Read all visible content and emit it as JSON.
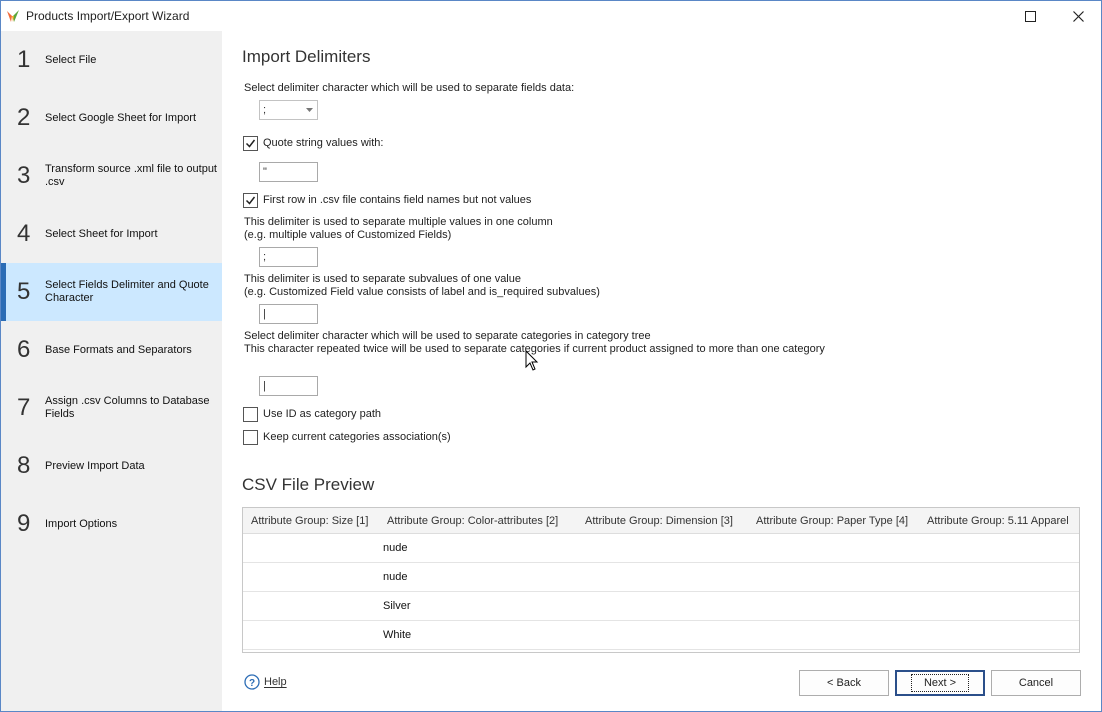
{
  "window": {
    "title": "Products Import/Export Wizard"
  },
  "sidebar": {
    "steps": [
      {
        "num": "1",
        "label": "Select File"
      },
      {
        "num": "2",
        "label": "Select Google Sheet for Import"
      },
      {
        "num": "3",
        "label": "Transform source .xml file to output .csv"
      },
      {
        "num": "4",
        "label": "Select Sheet for Import"
      },
      {
        "num": "5",
        "label": "Select Fields Delimiter and Quote Character"
      },
      {
        "num": "6",
        "label": "Base Formats and Separators"
      },
      {
        "num": "7",
        "label": "Assign .csv Columns to Database Fields"
      },
      {
        "num": "8",
        "label": "Preview Import Data"
      },
      {
        "num": "9",
        "label": "Import Options"
      }
    ]
  },
  "delimiters": {
    "title": "Import Delimiters",
    "field_delim_label": "Select delimiter character which will be used to separate fields data:",
    "field_delim_value": ";",
    "quote_label": "Quote string values with:",
    "quote_checked": true,
    "quote_value": "\"",
    "first_row_label": "First row in .csv file contains field names but not values",
    "first_row_checked": true,
    "multi_label_1": "This delimiter is used to separate multiple values in one column",
    "multi_label_2": "(e.g. multiple values of Customized Fields)",
    "multi_value": ";",
    "sub_label_1": "This delimiter is used to separate subvalues of one value",
    "sub_label_2": "(e.g. Customized Field value consists of label and is_required subvalues)",
    "sub_value": "|",
    "cat_label_1": "Select delimiter character which will be used to separate categories in category tree",
    "cat_label_2": "This character repeated twice will be used to separate categories if current product assigned to more than one category",
    "cat_value": "|",
    "use_id_label": "Use ID as category path",
    "use_id_checked": false,
    "keep_cat_label": "Keep current categories association(s)",
    "keep_cat_checked": false
  },
  "preview": {
    "title": "CSV File Preview",
    "columns": [
      "Attribute Group: Size [1]",
      "Attribute Group: Color-attributes [2]",
      "Attribute Group: Dimension [3]",
      "Attribute Group: Paper Type [4]",
      "Attribute Group: 5.11 Apparel"
    ],
    "rows": [
      "nude",
      "nude",
      "Silver",
      "White"
    ]
  },
  "footer": {
    "help": "Help",
    "back": "< Back",
    "next": "Next >",
    "cancel": "Cancel"
  }
}
